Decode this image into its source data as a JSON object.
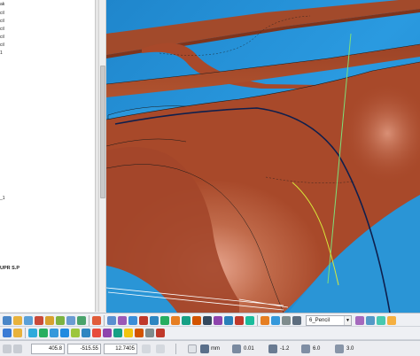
{
  "tree": {
    "items": [
      {
        "label": "ak"
      },
      {
        "label": "cil"
      },
      {
        "label": "cil"
      },
      {
        "label": "cil"
      },
      {
        "label": "cil"
      },
      {
        "label": "cil"
      },
      {
        "label": "1"
      },
      {
        "label": "_1"
      },
      {
        "label": "UPR S.P"
      }
    ]
  },
  "toolbar": {
    "tool_combo": "6_Pencil"
  },
  "status_bar": {
    "field_1": "405.8",
    "field_2": "-515.55",
    "field_3": "12.7405",
    "units": "mm",
    "tolerance": "0.01",
    "offset": "-1.2",
    "diameter": "6.0",
    "stock": "3.0"
  },
  "colors": {
    "background_blue": "#2a95d6",
    "surface_brown": "#a8492a",
    "toolpath_green": "#6ad46a"
  }
}
